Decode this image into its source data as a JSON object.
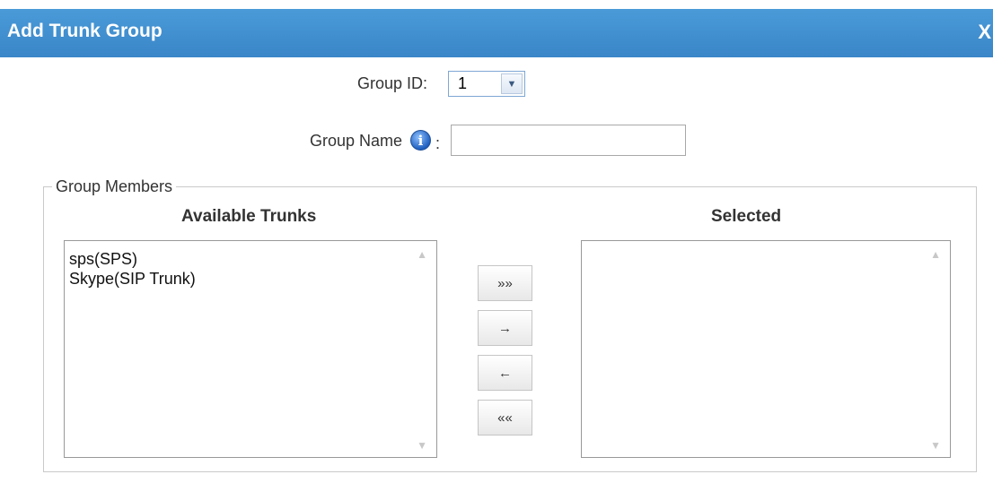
{
  "dialog": {
    "title": "Add Trunk Group",
    "close_label": "X"
  },
  "form": {
    "group_id_label": "Group ID:",
    "group_id_value": "1",
    "group_name_label": "Group Name",
    "group_name_colon": ":",
    "group_name_value": "",
    "info_glyph": "i"
  },
  "members": {
    "legend": "Group Members",
    "available_heading": "Available Trunks",
    "selected_heading": "Selected",
    "available_items": [
      "sps(SPS)",
      "Skype(SIP Trunk)"
    ],
    "selected_items": []
  },
  "buttons": {
    "add_all": "»»",
    "add_one": "→",
    "remove_one": "←",
    "remove_all": "««"
  },
  "icons": {
    "close": "close-icon",
    "info": "info-icon",
    "dropdown": "chevron-down-icon",
    "scroll_up": "scroll-up-arrow-icon",
    "scroll_down": "scroll-down-arrow-icon"
  },
  "colors": {
    "titlebar": "#3a86c8",
    "title_text": "#ffffff",
    "info_icon": "#1f5fbf"
  }
}
